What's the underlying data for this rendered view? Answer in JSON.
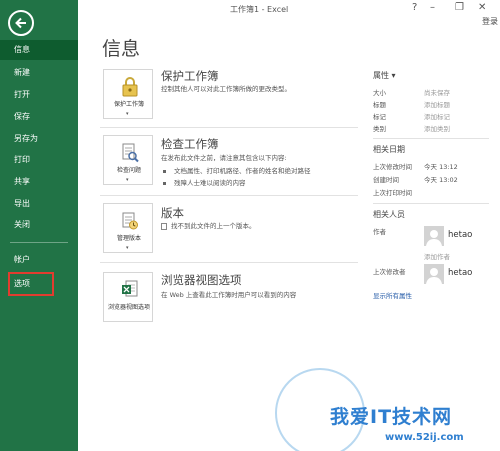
{
  "titlebar": {
    "title": "工作簿1 - Excel",
    "help": "?",
    "minimize": "–",
    "restore": "❐",
    "close": "✕",
    "login": "登录"
  },
  "sidebar": {
    "back_icon": "back-arrow-icon",
    "items": [
      {
        "label": "信息",
        "selected": true
      },
      {
        "label": "新建"
      },
      {
        "label": "打开"
      },
      {
        "label": "保存"
      },
      {
        "label": "另存为"
      },
      {
        "label": "打印"
      },
      {
        "label": "共享"
      },
      {
        "label": "导出"
      },
      {
        "label": "关闭"
      },
      {
        "label": "帐户"
      },
      {
        "label": "选项"
      }
    ],
    "bg_color": "#217346",
    "highlight_color": "#e23c2f"
  },
  "main": {
    "title": "信息",
    "sections": [
      {
        "tile_label": "保护工作簿",
        "icon": "lock-key-icon",
        "title": "保护工作簿",
        "desc": "控制其他人可以对此工作簿所做的更改类型。",
        "bullets": []
      },
      {
        "tile_label": "检查问题",
        "icon": "inspect-document-icon",
        "title": "检查工作簿",
        "desc": "在发布此文件之前，请注意其包含以下内容:",
        "bullets": [
          "文档属性、打印机路径、作者的姓名和绝对路径",
          "残障人士难以阅读的内容"
        ]
      },
      {
        "tile_label": "管理版本",
        "icon": "manage-versions-icon",
        "title": "版本",
        "desc": "找不到此文件的上一个版本。",
        "bullets": []
      },
      {
        "tile_label": "浏览器视图选项",
        "icon": "excel-browser-icon",
        "title": "浏览器视图选项",
        "desc": "在 Web 上查看此工作簿时用户可以看到的内容",
        "bullets": []
      }
    ]
  },
  "properties": {
    "header": "属性 ▾",
    "rows": [
      {
        "label": "大小",
        "value": "尚未保存"
      },
      {
        "label": "标题",
        "value": "添加标题"
      },
      {
        "label": "标记",
        "value": "添加标记"
      },
      {
        "label": "类别",
        "value": "添加类别"
      }
    ],
    "dates_header": "相关日期",
    "dates": [
      {
        "label": "上次修改时间",
        "value": "今天 13:12"
      },
      {
        "label": "创建时间",
        "value": "今天 13:02"
      },
      {
        "label": "上次打印时间",
        "value": ""
      }
    ],
    "people_header": "相关人员",
    "author_label": "作者",
    "author_name": "hetao",
    "add_author": "添加作者",
    "modified_by_label": "上次修改者",
    "modified_by_name": "hetao",
    "show_all": "显示所有属性"
  },
  "watermark": {
    "text": "我爱IT技术网",
    "url": "www.52ij.com"
  }
}
